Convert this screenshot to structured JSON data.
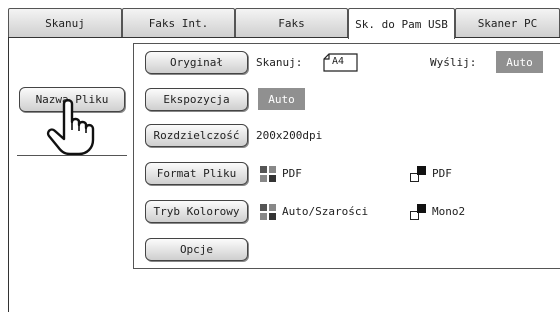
{
  "tabs": [
    {
      "label": "Skanuj",
      "active": false
    },
    {
      "label": "Faks Int.",
      "active": false
    },
    {
      "label": "Faks",
      "active": false
    },
    {
      "label": "Sk. do Pam USB",
      "active": true
    },
    {
      "label": "Skaner PC",
      "active": false
    }
  ],
  "left": {
    "filename_button": "Nazwa Pliku"
  },
  "rows": {
    "original": {
      "button": "Oryginał",
      "scan_label": "Skanuj:",
      "paper_size": "A4",
      "send_label": "Wyślij:",
      "send_value": "Auto"
    },
    "exposure": {
      "button": "Ekspozycja",
      "value": "Auto"
    },
    "resolution": {
      "button": "Rozdzielczość",
      "value": "200x200dpi"
    },
    "file_format": {
      "button": "Format Pliku",
      "color_value": "PDF",
      "mono_value": "PDF"
    },
    "color_mode": {
      "button": "Tryb Kolorowy",
      "color_value": "Auto/Szarości",
      "mono_value": "Mono2"
    },
    "options": {
      "button": "Opcje"
    }
  },
  "colors": {
    "auto_box": "#909090",
    "border": "#444444"
  },
  "icons": {
    "paper": "a4-paper-icon",
    "color": "color-quad-icon",
    "mono": "mono-icon",
    "hand": "pointing-hand-icon"
  }
}
